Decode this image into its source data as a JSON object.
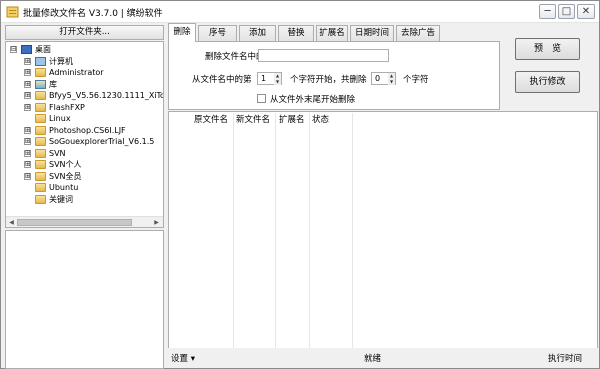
{
  "window": {
    "title": "批量修改文件名 V3.7.0 | 缤纷软件",
    "controls": {
      "minimize": "─",
      "maximize": "□",
      "close": "✕"
    }
  },
  "left_panel": {
    "open_folder_button": "打开文件夹...",
    "tree": [
      {
        "label": "桌面",
        "icon": "desktop-icon",
        "expander": "⊟"
      },
      {
        "label": "计算机",
        "icon": "computer-icon",
        "expander": "⊞"
      },
      {
        "label": "Administrator",
        "icon": "user-folder-icon",
        "expander": "⊞"
      },
      {
        "label": "库",
        "icon": "library-icon",
        "expander": "⊞"
      },
      {
        "label": "Bfyy5_V5.56.1230.1111_XiTo",
        "icon": "folder-icon",
        "expander": "⊞"
      },
      {
        "label": "FlashFXP",
        "icon": "folder-icon",
        "expander": "⊞"
      },
      {
        "label": "Linux",
        "icon": "folder-icon",
        "expander": ""
      },
      {
        "label": "Photoshop.CS6I.LJF",
        "icon": "folder-icon",
        "expander": "⊞"
      },
      {
        "label": "SoGouexplorerTrial_V6.1.5",
        "icon": "folder-icon",
        "expander": "⊞"
      },
      {
        "label": "SVN",
        "icon": "folder-icon",
        "expander": "⊞"
      },
      {
        "label": "SVN个人",
        "icon": "folder-icon",
        "expander": "⊞"
      },
      {
        "label": "SVN全员",
        "icon": "folder-icon",
        "expander": "⊞"
      },
      {
        "label": "Ubuntu",
        "icon": "folder-icon",
        "expander": ""
      },
      {
        "label": "关键词",
        "icon": "folder-icon",
        "expander": ""
      }
    ]
  },
  "tabs": [
    "删除",
    "序号",
    "添加",
    "替换",
    "扩展名",
    "日期时间",
    "去除广告"
  ],
  "delete_panel": {
    "remove_in_name_label": "删除文件名中的",
    "remove_in_name_value": "",
    "from_position_prefix": "从文件名中的第",
    "start_value": "1",
    "from_position_middle": "个字符开始，共删除",
    "count_value": "0",
    "from_position_suffix": "个字符",
    "from_end_checkbox_label": "从文件外末尾开始删除"
  },
  "buttons": {
    "preview": "预　览",
    "execute": "执行修改"
  },
  "file_list": {
    "columns": [
      "原文件名",
      "新文件名",
      "扩展名",
      "状态"
    ]
  },
  "status_bar": {
    "settings": "设置",
    "settings_arrow": "▾",
    "status": "就绪",
    "exec_time": "执行时间"
  },
  "colors": {
    "folder": "#e5b94e",
    "window_bg": "#f0f0f0",
    "border": "#adadad"
  }
}
